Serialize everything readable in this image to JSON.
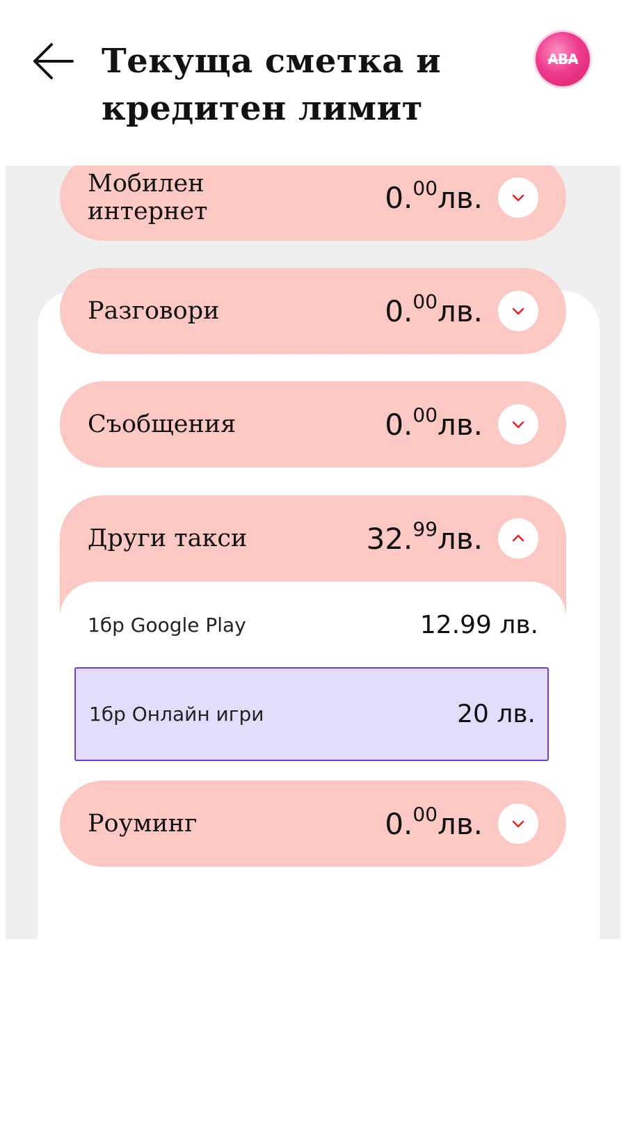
{
  "header": {
    "back_icon": "arrow-left-icon",
    "title": "Текуща сметка и кредитен лимит",
    "logo_text": "ABA"
  },
  "colors": {
    "row_bg": "#fbc8c3",
    "accent_red": "#e52421",
    "highlight_bg": "#e3dcfb",
    "highlight_border": "#6b3fd2",
    "page_bg": "#efefef"
  },
  "categories": [
    {
      "label": "Мобилен интернет",
      "amount_whole": "0.",
      "amount_cents": "00",
      "currency": "лв.",
      "expanded": false,
      "chevron_icon": "chevron-down-icon"
    },
    {
      "label": "Разговори",
      "amount_whole": "0.",
      "amount_cents": "00",
      "currency": "лв.",
      "expanded": false,
      "chevron_icon": "chevron-down-icon"
    },
    {
      "label": "Съобщения",
      "amount_whole": "0.",
      "amount_cents": "00",
      "currency": "лв.",
      "expanded": false,
      "chevron_icon": "chevron-down-icon"
    },
    {
      "label": "Други такси",
      "amount_whole": "32.",
      "amount_cents": "99",
      "currency": "лв.",
      "expanded": true,
      "chevron_icon": "chevron-up-icon"
    },
    {
      "label": "Роуминг",
      "amount_whole": "0.",
      "amount_cents": "00",
      "currency": "лв.",
      "expanded": false,
      "chevron_icon": "chevron-down-icon"
    }
  ],
  "other_fees_items": [
    {
      "label": "1бр Google Play",
      "amount": "12.99 лв."
    },
    {
      "label": "1бр Онлайн игри",
      "amount": "20 лв."
    }
  ]
}
